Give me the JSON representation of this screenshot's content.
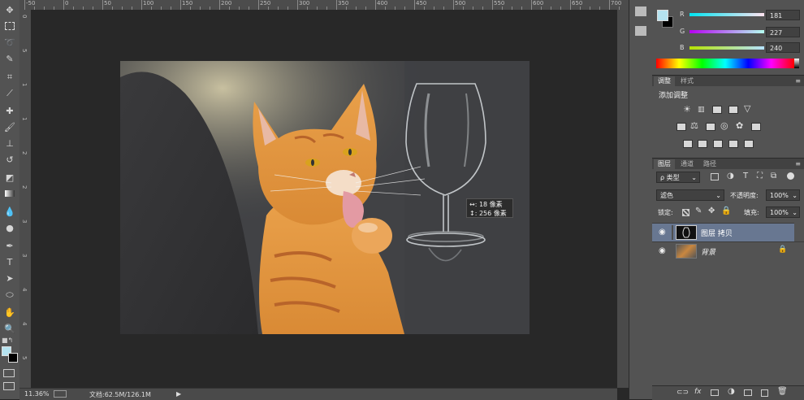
{
  "ruler": {
    "top_labels": [
      "-50",
      "0",
      "50",
      "100",
      "150",
      "200",
      "250",
      "300",
      "350",
      "400",
      "450",
      "500",
      "550",
      "600",
      "650",
      "700",
      "750"
    ],
    "left_labels": [
      "0",
      "5",
      "1",
      "1",
      "2",
      "2",
      "3",
      "3",
      "4",
      "4",
      "5"
    ]
  },
  "status": {
    "zoom": "11.36%",
    "doc_info": "文档:62.5M/126.1M"
  },
  "measure": {
    "width_label": "↔:",
    "width_value": "18 像素",
    "height_label": "↕:",
    "height_value": "256 像素"
  },
  "color": {
    "foreground": "#b5e3f0",
    "background": "#000000",
    "r_label": "R",
    "r_value": "181",
    "g_label": "G",
    "g_value": "227",
    "b_label": "B",
    "b_value": "240"
  },
  "adjust_panel": {
    "tabs": [
      "调整",
      "样式"
    ],
    "title": "添加调整"
  },
  "layers_panel": {
    "tabs": [
      "图层",
      "通道",
      "路径"
    ],
    "filter_label": "ρ 类型",
    "blend_mode": "滤色",
    "opacity_label": "不透明度:",
    "opacity_value": "100%",
    "lock_label": "锁定:",
    "fill_label": "填充:",
    "fill_value": "100%",
    "layers": [
      {
        "name": "图层 拷贝",
        "selected": true
      },
      {
        "name": "背景",
        "selected": false
      }
    ]
  },
  "icons": {
    "toolbar": [
      "move-icon",
      "marquee-icon",
      "lasso-icon",
      "quick-select-icon",
      "crop-icon",
      "eyedropper-icon",
      "healing-icon",
      "brush-icon",
      "stamp-icon",
      "history-brush-icon",
      "eraser-icon",
      "gradient-icon",
      "blur-icon",
      "dodge-icon",
      "pen-icon",
      "type-icon",
      "path-select-icon",
      "shape-icon",
      "hand-icon",
      "zoom-icon"
    ]
  }
}
